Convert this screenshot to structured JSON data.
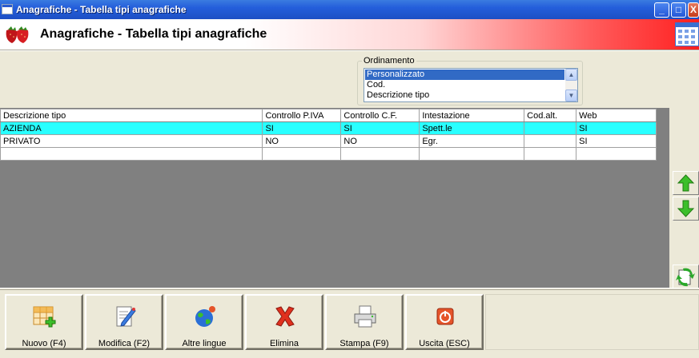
{
  "window": {
    "title": "Anagrafiche - Tabella tipi anagrafiche",
    "minimize_label": "_",
    "maximize_label": "□",
    "close_label": "X"
  },
  "header": {
    "title": "Anagrafiche - Tabella tipi anagrafiche"
  },
  "ordinamento": {
    "label": "Ordinamento",
    "options": [
      "Personalizzato",
      "Cod.",
      "Descrizione tipo"
    ],
    "selected": "Personalizzato"
  },
  "grid": {
    "columns": [
      "Descrizione tipo",
      "Controllo P.IVA",
      "Controllo C.F.",
      "Intestazione",
      "Cod.alt.",
      "Web"
    ],
    "rows": [
      [
        "AZIENDA",
        "SI",
        "SI",
        "Spett.le",
        "",
        "SI"
      ],
      [
        "PRIVATO",
        "NO",
        "NO",
        "Egr.",
        "",
        "SI"
      ],
      [
        "",
        "",
        "",
        "",
        "",
        ""
      ]
    ],
    "highlight_color": "#29ffff"
  },
  "toolbar": {
    "nuovo": "Nuovo (F4)",
    "modifica": "Modifica (F2)",
    "altre_lingue": "Altre lingue",
    "elimina": "Elimina",
    "stampa": "Stampa (F9)",
    "uscita": "Uscita (ESC)"
  },
  "icons": {
    "up": "arrow-up-icon",
    "down": "arrow-down-icon",
    "refresh": "refresh-icon"
  },
  "colors": {
    "titlebar": "#245edb",
    "header_gradient_end": "#ff1f1f",
    "grid_bg": "#808080"
  }
}
